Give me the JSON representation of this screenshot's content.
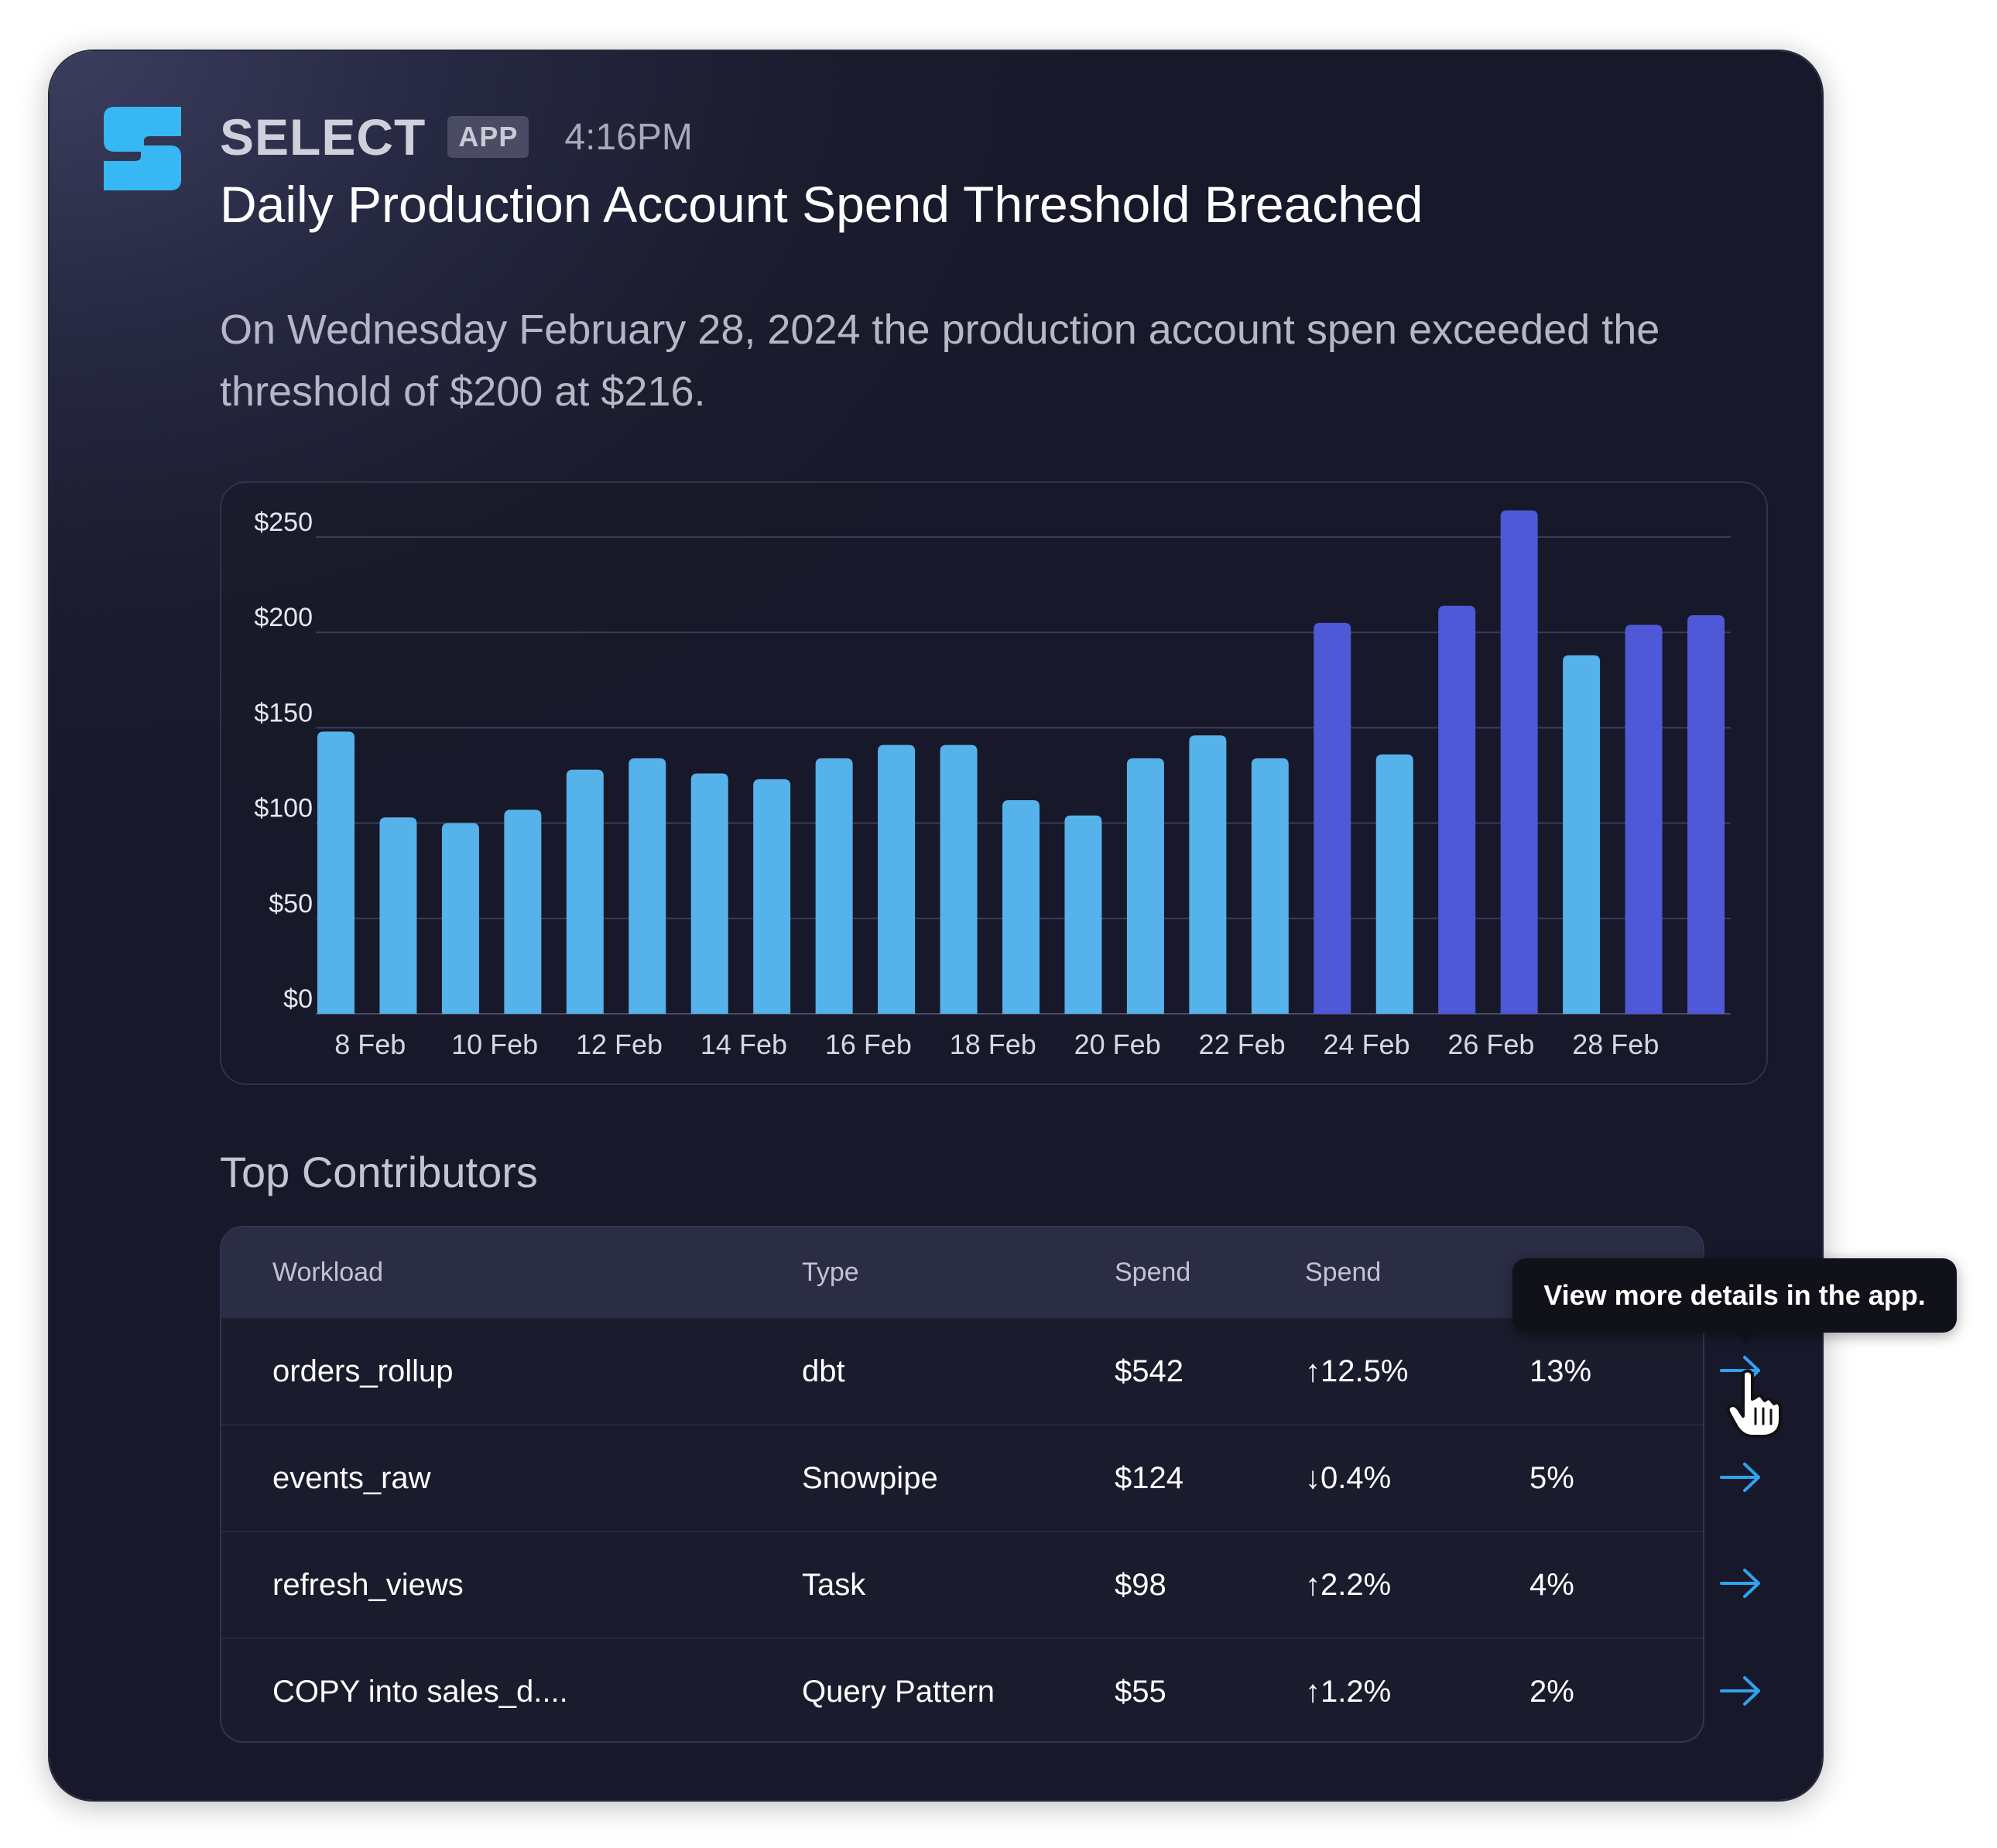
{
  "app": {
    "name": "SELECT",
    "badge": "APP",
    "time": "4:16PM"
  },
  "alert": {
    "title": "Daily Production Account Spend Threshold Breached",
    "description": "On Wednesday February 28, 2024 the production account spen exceeded the threshold of $200 at $216."
  },
  "colors": {
    "normal_bar": "#56b2ea",
    "breach_bar": "#4f58d6",
    "accent": "#2ea3f2",
    "logo": "#37b8f5"
  },
  "chart_data": {
    "type": "bar",
    "categories": [
      "8 Feb",
      "9 Feb",
      "10 Feb",
      "11 Feb",
      "12 Feb",
      "13 Feb",
      "14 Feb",
      "15 Feb",
      "16 Feb",
      "17 Feb",
      "18 Feb",
      "19 Feb",
      "20 Feb",
      "21 Feb",
      "22 Feb",
      "23 Feb",
      "24 Feb",
      "25 Feb",
      "26 Feb",
      "27 Feb",
      "28 Feb",
      "29 Feb",
      "1 Mar"
    ],
    "tick_labels": [
      "8 Feb",
      "10 Feb",
      "12 Feb",
      "14 Feb",
      "16 Feb",
      "18 Feb",
      "20 Feb",
      "22 Feb",
      "24 Feb",
      "26 Feb",
      "28 Feb"
    ],
    "values": [
      148,
      103,
      100,
      107,
      128,
      134,
      126,
      123,
      134,
      141,
      141,
      112,
      104,
      134,
      146,
      134,
      205,
      136,
      214,
      264,
      188,
      204,
      209
    ],
    "breached": [
      false,
      false,
      false,
      false,
      false,
      false,
      false,
      false,
      false,
      false,
      false,
      false,
      false,
      false,
      false,
      false,
      true,
      false,
      true,
      true,
      false,
      true,
      true
    ],
    "y_ticks": [
      "$250",
      "$200",
      "$150",
      "$100",
      "$50",
      "$0"
    ],
    "y_tick_values": [
      250,
      200,
      150,
      100,
      50,
      0
    ],
    "ylim": [
      0,
      264
    ],
    "threshold": 200,
    "grid": true
  },
  "contributors": {
    "section_title": "Top Contributors",
    "headers": [
      "Workload",
      "Type",
      "Spend",
      "Spend"
    ],
    "rows": [
      {
        "workload": "orders_rollup",
        "type": "dbt",
        "spend": "$542",
        "change": "↑12.5%",
        "share": "13%"
      },
      {
        "workload": "events_raw",
        "type": "Snowpipe",
        "spend": "$124",
        "change": "↓0.4%",
        "share": "5%"
      },
      {
        "workload": "refresh_views",
        "type": "Task",
        "spend": "$98",
        "change": "↑2.2%",
        "share": "4%"
      },
      {
        "workload": "COPY into sales_d....",
        "type": "Query Pattern",
        "spend": "$55",
        "change": "↑1.2%",
        "share": "2%"
      }
    ]
  },
  "tooltip": {
    "text": "View more details in the app."
  }
}
